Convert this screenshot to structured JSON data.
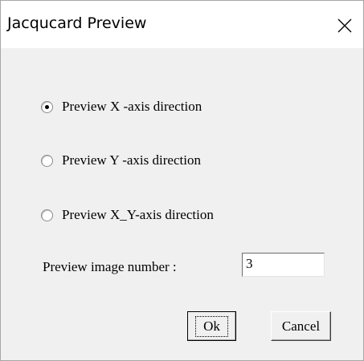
{
  "dialog": {
    "title": "Jacqucard Preview",
    "close_icon": "close-icon"
  },
  "options": [
    {
      "label": "Preview X -axis direction",
      "checked": true
    },
    {
      "label": "Preview Y -axis direction",
      "checked": false
    },
    {
      "label": "Preview X_Y-axis direction",
      "checked": false
    }
  ],
  "image_number": {
    "label": "Preview image number :",
    "value": "3"
  },
  "buttons": {
    "ok": "Ok",
    "cancel": "Cancel"
  }
}
